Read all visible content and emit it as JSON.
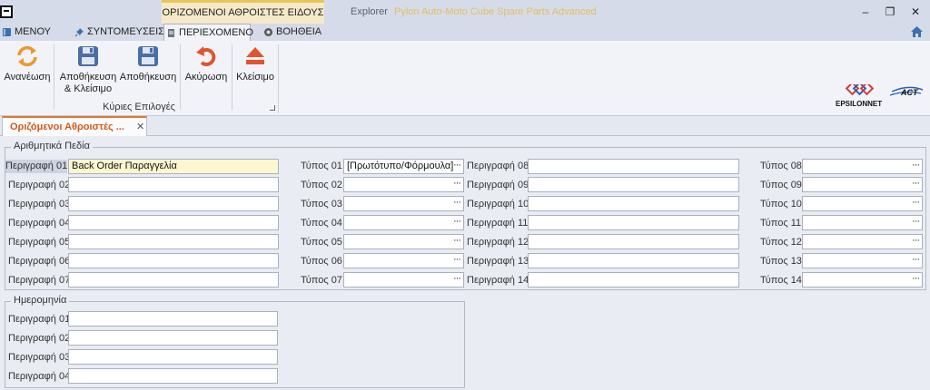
{
  "window": {
    "context_title": "ΟΡΙΖΟΜΕΝΟΙ ΑΘΡΟΙΣΤΕΣ ΕΙΔΟΥΣ",
    "explorer_label": "Explorer",
    "app_name": "Pylon Auto-Moto Cube Spare Parts Advanced",
    "minimize": "–",
    "maximize": "❐",
    "close": "✕"
  },
  "tabs": [
    {
      "label": "ΜΕΝΟΥ",
      "icon": "book-icon"
    },
    {
      "label": "ΣΥΝΤΟΜΕΥΣΕΙΣ",
      "icon": "pin-icon"
    },
    {
      "label": "ΠΕΡΙΕΧΟΜΕΝΟ",
      "icon": "document-icon"
    },
    {
      "label": "ΒΟΗΘΕΙΑ",
      "icon": "help-icon"
    }
  ],
  "ribbon": {
    "refresh": "Ανανέωση",
    "save_close_1": "Αποθήκευση",
    "save_close_2": "& Κλείσιμο",
    "save": "Αποθήκευση",
    "cancel": "Ακύρωση",
    "close": "Κλείσιμο",
    "group_label": "Κύριες Επιλογές"
  },
  "logo": {
    "text": "EPSILONNET",
    "partner": "ACT"
  },
  "doc_tab": {
    "label": "Οριζόμενοι Αθροιστές ...",
    "close": "✕"
  },
  "numeric": {
    "title": "Αριθμητικά Πεδία",
    "col1": [
      {
        "label": "Περιγραφή 01",
        "value": "Back Order Παραγγελία"
      },
      {
        "label": "Περιγραφή 02",
        "value": ""
      },
      {
        "label": "Περιγραφή 03",
        "value": ""
      },
      {
        "label": "Περιγραφή 04",
        "value": ""
      },
      {
        "label": "Περιγραφή 05",
        "value": ""
      },
      {
        "label": "Περιγραφή 06",
        "value": ""
      },
      {
        "label": "Περιγραφή 07",
        "value": ""
      }
    ],
    "col2": [
      {
        "label": "Τύπος 01",
        "value": "[Πρωτότυπο/Φόρμουλα]"
      },
      {
        "label": "Τύπος 02",
        "value": ""
      },
      {
        "label": "Τύπος 03",
        "value": ""
      },
      {
        "label": "Τύπος 04",
        "value": ""
      },
      {
        "label": "Τύπος 05",
        "value": ""
      },
      {
        "label": "Τύπος 06",
        "value": ""
      },
      {
        "label": "Τύπος 07",
        "value": ""
      }
    ],
    "col3": [
      {
        "label": "Περιγραφή 08",
        "value": ""
      },
      {
        "label": "Περιγραφή 09",
        "value": ""
      },
      {
        "label": "Περιγραφή 10",
        "value": ""
      },
      {
        "label": "Περιγραφή 11",
        "value": ""
      },
      {
        "label": "Περιγραφή 12",
        "value": ""
      },
      {
        "label": "Περιγραφή 13",
        "value": ""
      },
      {
        "label": "Περιγραφή 14",
        "value": ""
      }
    ],
    "col4": [
      {
        "label": "Τύπος 08",
        "value": ""
      },
      {
        "label": "Τύπος 09",
        "value": ""
      },
      {
        "label": "Τύπος 10",
        "value": ""
      },
      {
        "label": "Τύπος 11",
        "value": ""
      },
      {
        "label": "Τύπος 12",
        "value": ""
      },
      {
        "label": "Τύπος 13",
        "value": ""
      },
      {
        "label": "Τύπος 14",
        "value": ""
      }
    ]
  },
  "date": {
    "title": "Ημερομηνία",
    "rows": [
      {
        "label": "Περιγραφή 01",
        "value": ""
      },
      {
        "label": "Περιγραφή 02",
        "value": ""
      },
      {
        "label": "Περιγραφή 03",
        "value": ""
      },
      {
        "label": "Περιγραφή 04",
        "value": ""
      }
    ]
  },
  "lookup_dots": "···"
}
